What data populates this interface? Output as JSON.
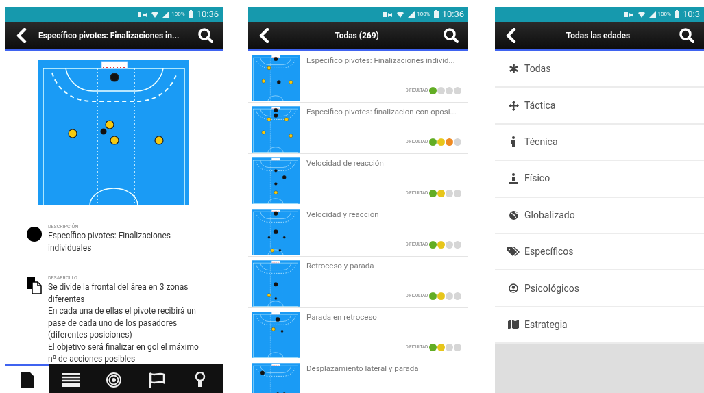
{
  "detail_screen": {
    "status_bar": {
      "battery": "100%",
      "time": "10:36"
    },
    "app_bar": {
      "title": "Específico pivotes: Finalizaciones in..."
    },
    "sections": [
      {
        "label": "DESCRIPCIÓN",
        "paragraphs": [
          "Específico pivotes: Finalizaciones individuales"
        ]
      },
      {
        "label": "DESARROLLO",
        "paragraphs": [
          "Se divide la frontal del área en 3 zonas diferentes",
          "En cada una de ellas el pivote recibirá un pase de cada uno de los pasadores (diferentes posiciones)",
          "El objetivo será finalizar en gol el máximo nº de acciones posibles"
        ]
      }
    ],
    "bottom_nav": [
      {
        "selected": true
      },
      {
        "selected": false
      },
      {
        "selected": false
      },
      {
        "selected": false
      },
      {
        "selected": false
      }
    ]
  },
  "list_screen": {
    "status_bar": {
      "battery": "100%",
      "time": "10:36"
    },
    "app_bar": {
      "title": "Todas (269)"
    },
    "rows": [
      {
        "title": "Especifico pivotes: Finalizaciones individ...",
        "difficulty_label": "DIFICULTAD",
        "difficulty": [
          {
            "color": "#62ad24"
          },
          {
            "color": "#d6d6d6"
          },
          {
            "color": "#d6d6d6"
          },
          {
            "color": "#d6d6d6"
          }
        ]
      },
      {
        "title": "Especifico pivotes: finalizacion con oposi...",
        "difficulty_label": "DIFICULTAD",
        "difficulty": [
          {
            "color": "#62ad24"
          },
          {
            "color": "#e7c61b"
          },
          {
            "color": "#ef8a22"
          },
          {
            "color": "#d6d6d6"
          }
        ]
      },
      {
        "title": "Velocidad de reacción",
        "difficulty_label": "DIFICULTAD",
        "difficulty": [
          {
            "color": "#62ad24"
          },
          {
            "color": "#e7c61b"
          },
          {
            "color": "#d6d6d6"
          },
          {
            "color": "#d6d6d6"
          }
        ]
      },
      {
        "title": "Velocidad y reacción",
        "difficulty_label": "DIFICULTAD",
        "difficulty": [
          {
            "color": "#62ad24"
          },
          {
            "color": "#e7c61b"
          },
          {
            "color": "#d6d6d6"
          },
          {
            "color": "#d6d6d6"
          }
        ]
      },
      {
        "title": "Retroceso y parada",
        "difficulty_label": "DIFICULTAD",
        "difficulty": [
          {
            "color": "#62ad24"
          },
          {
            "color": "#e7c61b"
          },
          {
            "color": "#d6d6d6"
          },
          {
            "color": "#d6d6d6"
          }
        ]
      },
      {
        "title": "Parada en retroceso",
        "difficulty_label": "DIFICULTAD",
        "difficulty": [
          {
            "color": "#62ad24"
          },
          {
            "color": "#e7c61b"
          },
          {
            "color": "#d6d6d6"
          },
          {
            "color": "#d6d6d6"
          }
        ]
      },
      {
        "title": "Desplazamiento lateral y parada"
      }
    ]
  },
  "category_screen": {
    "status_bar": {
      "battery": "100%",
      "time": "10:3"
    },
    "app_bar": {
      "title": "Todas las edades"
    },
    "items": [
      {
        "label": "Todas"
      },
      {
        "label": "Táctica"
      },
      {
        "label": "Técnica"
      },
      {
        "label": "Físico"
      },
      {
        "label": "Globalizado"
      },
      {
        "label": "Específicos"
      },
      {
        "label": "Psicológicos"
      },
      {
        "label": "Estrategia"
      }
    ]
  }
}
